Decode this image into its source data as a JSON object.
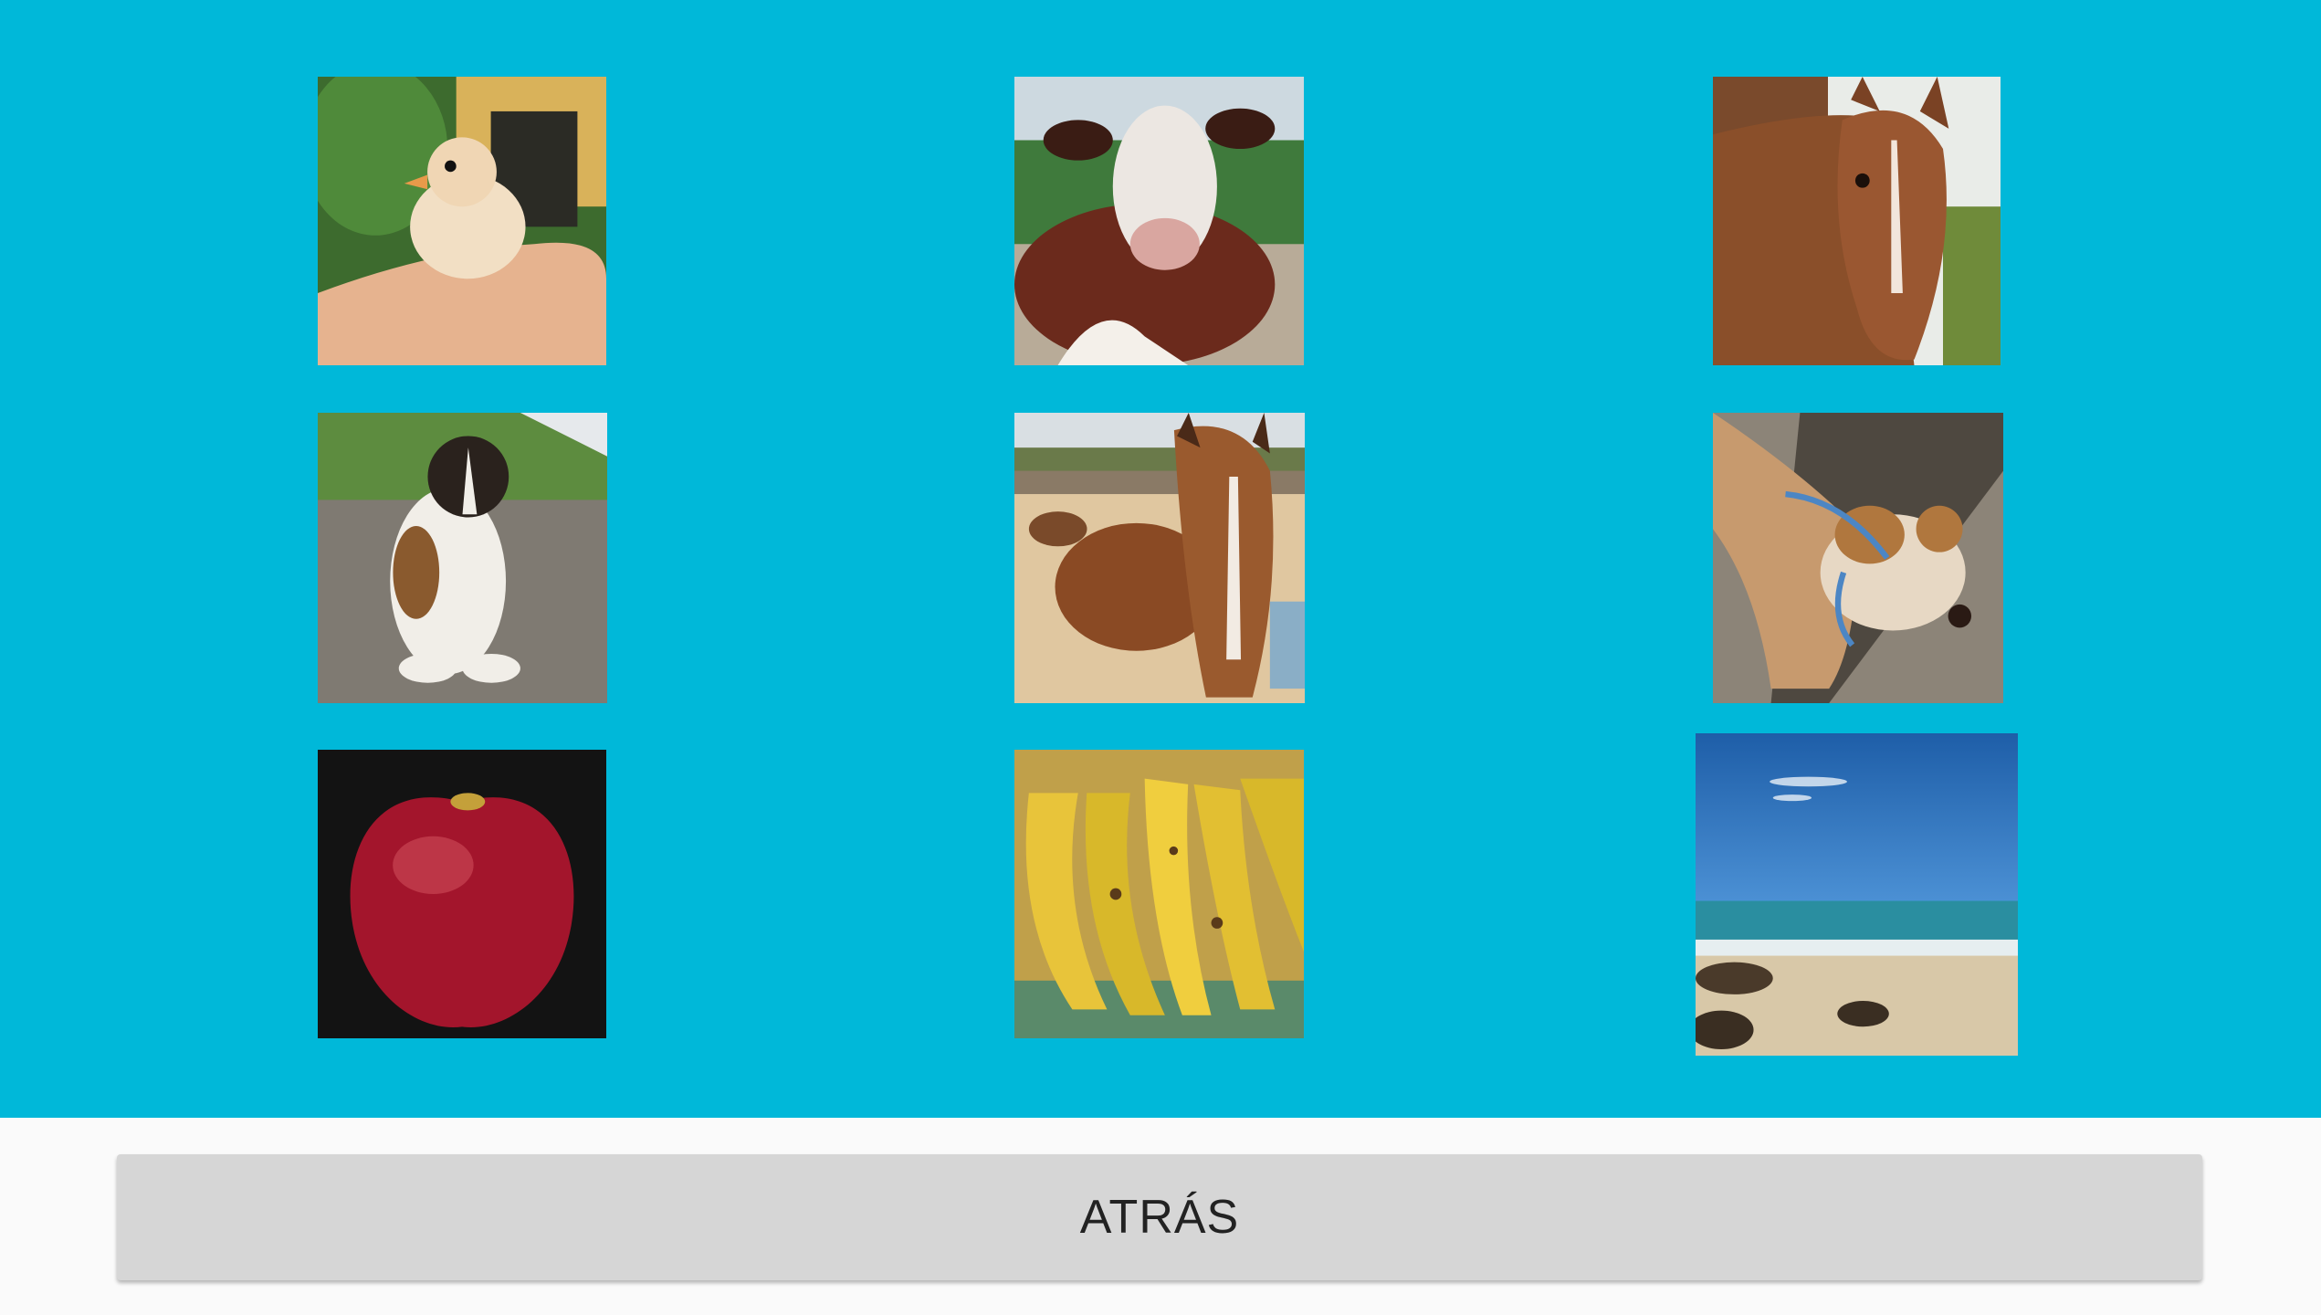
{
  "colors": {
    "stage_background": "#00b8d9",
    "footer_background": "#fafafa",
    "button_background": "#d6d6d6"
  },
  "grid": {
    "images": [
      {
        "subject": "chick"
      },
      {
        "subject": "cow"
      },
      {
        "subject": "horse"
      },
      {
        "subject": "dog"
      },
      {
        "subject": "horse"
      },
      {
        "subject": "dog"
      },
      {
        "subject": "apple"
      },
      {
        "subject": "bananas"
      },
      {
        "subject": "beach"
      }
    ]
  },
  "footer": {
    "back_label": "ATRÁS"
  }
}
